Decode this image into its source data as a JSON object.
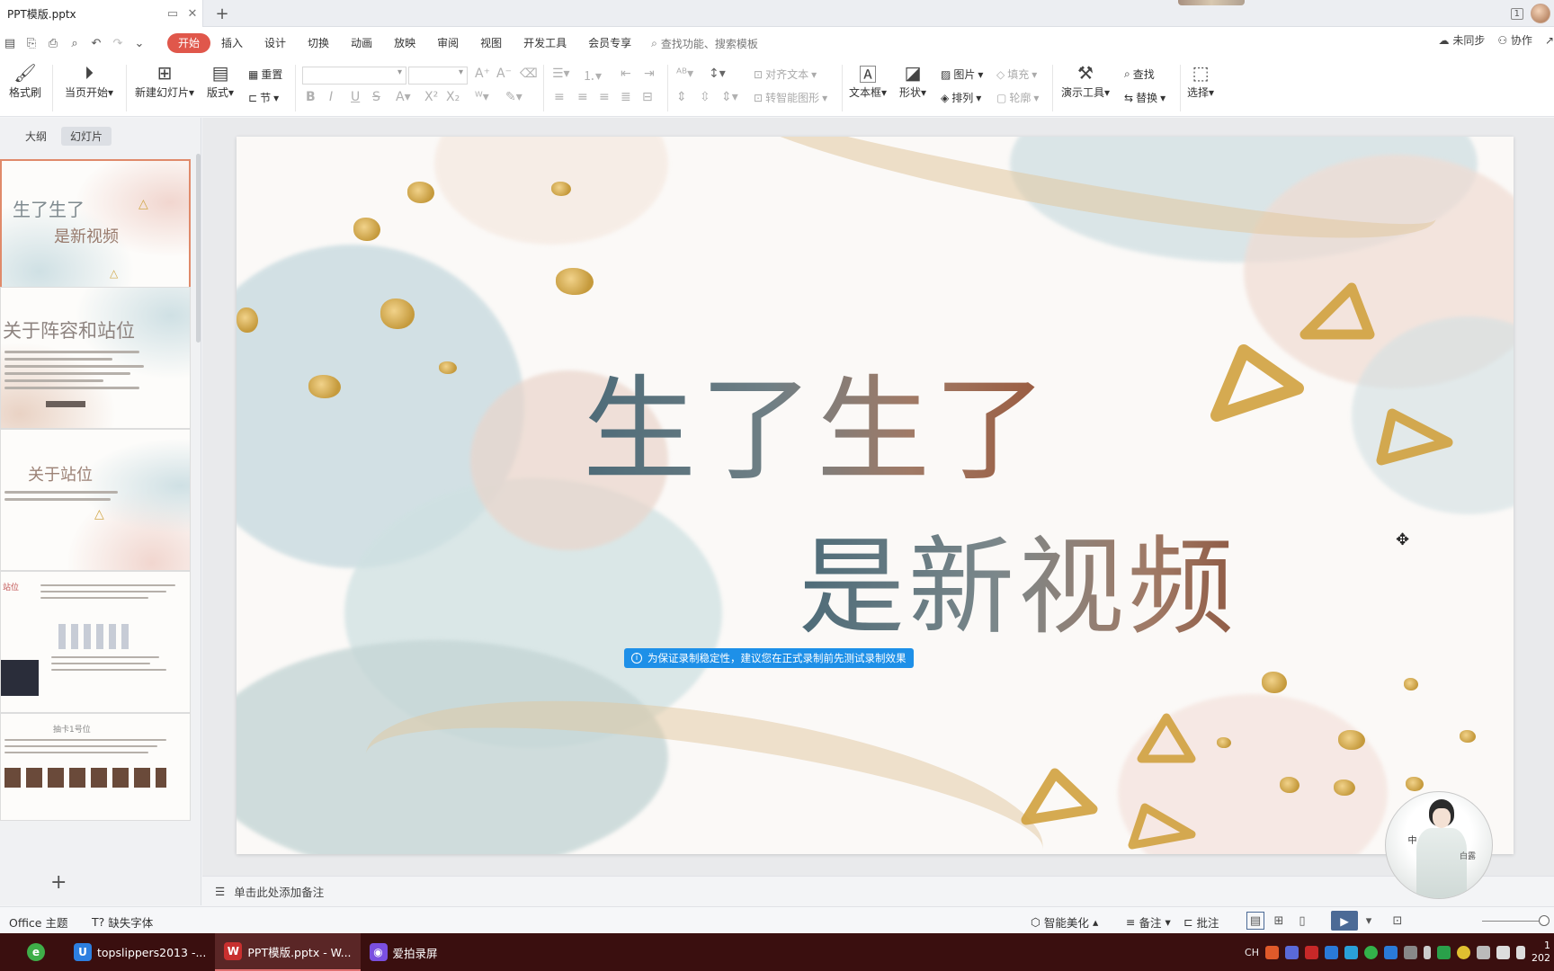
{
  "window": {
    "doc_tab": "PPT模版.pptx",
    "new_tab": "+",
    "badge": "1"
  },
  "menu": {
    "items": [
      "开始",
      "插入",
      "设计",
      "切换",
      "动画",
      "放映",
      "审阅",
      "视图",
      "开发工具",
      "会员专享"
    ],
    "search": "查找功能、搜索模板",
    "unsynced": "未同步",
    "collab": "协作"
  },
  "ribbon": {
    "format_painter": "格式刷",
    "play_from_current": "当页开始",
    "new_slide": "新建幻灯片",
    "layout": "版式",
    "reset": "重置",
    "section": "节",
    "align_text": "对齐文本",
    "smartart": "转智能图形",
    "textbox": "文本框",
    "shape": "形状",
    "picture": "图片",
    "fill": "填充",
    "arrange": "排列",
    "outline": "轮廓",
    "present_tool": "演示工具",
    "find": "查找",
    "replace": "替换",
    "select": "选择"
  },
  "left_panel": {
    "tab_outline": "大纲",
    "tab_slides": "幻灯片",
    "thumbs": [
      {
        "line1": "生了生了",
        "line2": "是新视频"
      },
      {
        "title": "关于阵容和站位"
      },
      {
        "title": "关于站位"
      },
      {
        "title": "站位"
      },
      {
        "title": "抽卡1号位"
      }
    ],
    "add": "+"
  },
  "slide": {
    "title_line1": "生了生了",
    "title_line2": "是新视频",
    "tip": "为保证录制稳定性，建议您在正式录制前先测试录制效果"
  },
  "notes": {
    "placeholder": "单击此处添加备注"
  },
  "status": {
    "theme": "Office 主题",
    "missing_font": "缺失字体",
    "beautify": "智能美化",
    "notes": "备注",
    "comment": "批注"
  },
  "mascot": {
    "left": "中",
    "right": "白露"
  },
  "taskbar": {
    "items": [
      {
        "label": "topslippers2013 -...",
        "icon": "U"
      },
      {
        "label": "PPT模版.pptx - W...",
        "icon": "W"
      },
      {
        "label": "爱拍录屏",
        "icon": "◉"
      }
    ],
    "lang": "CH",
    "clock_time": "1",
    "clock_date": "202"
  },
  "colors": {
    "accent": "#e0574b",
    "tip_blue": "#1e90e8",
    "taskbar": "#3a0f0f",
    "title_start": "#4d6b78",
    "title_end": "#9a5a3e"
  }
}
